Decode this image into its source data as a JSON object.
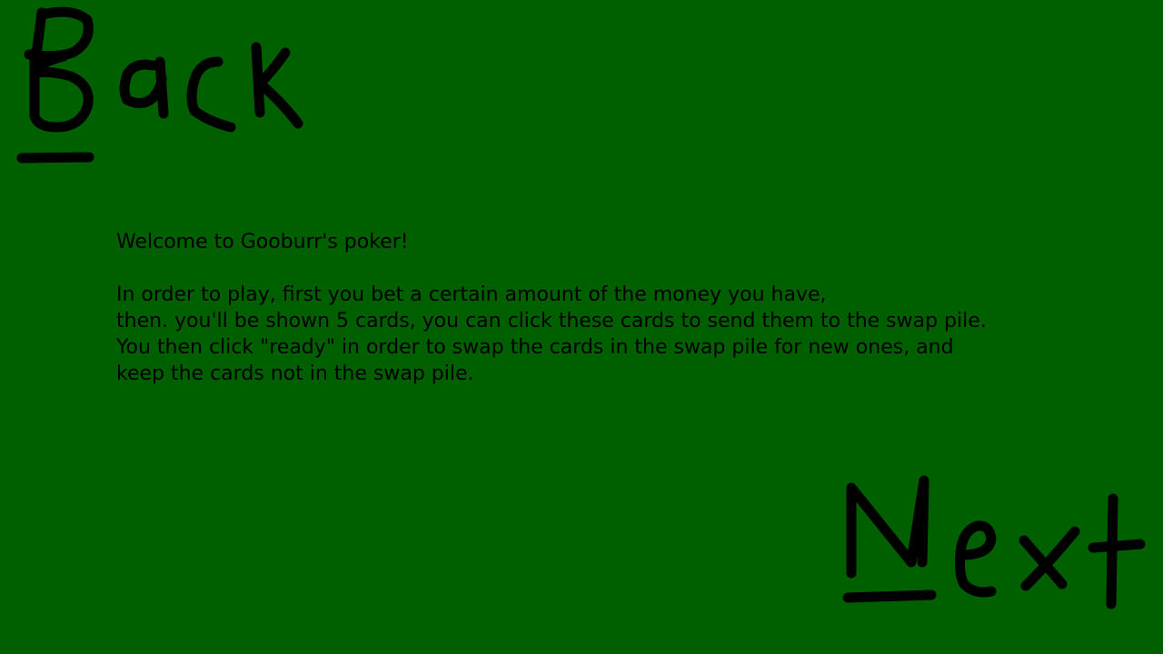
{
  "screen": {
    "background_color": "#006000",
    "ink_color": "#000000"
  },
  "nav": {
    "back_label": "Back",
    "next_label": "Next"
  },
  "instructions": {
    "welcome": "Welcome to Gooburr's poker!",
    "lines": [
      "In order to play, first you bet a certain amount of the money you have,",
      "then. you'll be shown 5 cards, you can click these cards to send them to the swap pile.",
      "You then click \"ready\" in order to swap the cards in the swap pile for new ones, and",
      "keep the cards not in the swap pile."
    ]
  }
}
